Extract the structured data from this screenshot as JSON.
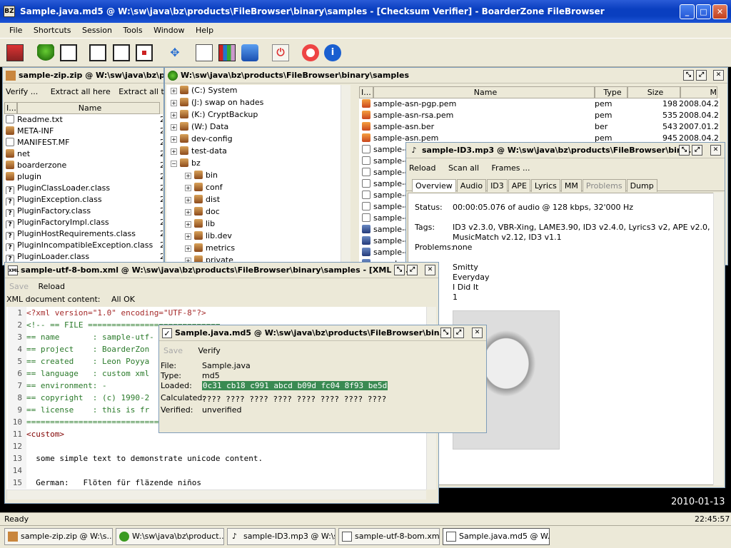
{
  "app": {
    "title": "Sample.java.md5 @ W:\\sw\\java\\bz\\products\\FileBrowser\\binary\\samples - [Checksum Verifier] - BoarderZone FileBrowser"
  },
  "menu": [
    "File",
    "Shortcuts",
    "Session",
    "Tools",
    "Window",
    "Help"
  ],
  "zip": {
    "title": "sample-zip.zip @ W:\\sw\\java\\bz\\pi",
    "actions": [
      "Verify ...",
      "Extract all here",
      "Extract all to ..."
    ],
    "col_i": "I...",
    "col_name": "Name",
    "rows": [
      {
        "name": "Readme.txt",
        "icon": "file",
        "n": "2"
      },
      {
        "name": "META-INF",
        "icon": "folder",
        "n": "2"
      },
      {
        "name": "MANIFEST.MF",
        "icon": "file",
        "n": "2"
      },
      {
        "name": "net",
        "icon": "folder",
        "n": "2"
      },
      {
        "name": "boarderzone",
        "icon": "folder",
        "n": "2"
      },
      {
        "name": "plugin",
        "icon": "folder",
        "n": "2"
      },
      {
        "name": "PluginClassLoader.class",
        "icon": "q",
        "n": "2"
      },
      {
        "name": "PluginException.class",
        "icon": "q",
        "n": "2"
      },
      {
        "name": "PluginFactory.class",
        "icon": "q",
        "n": "2"
      },
      {
        "name": "PluginFactoryImpl.class",
        "icon": "q",
        "n": "2"
      },
      {
        "name": "PluginHostRequirements.class",
        "icon": "q",
        "n": "2"
      },
      {
        "name": "PluginIncompatibleException.class",
        "icon": "q",
        "n": "2"
      },
      {
        "name": "PluginLoader.class",
        "icon": "q",
        "n": "2"
      }
    ]
  },
  "browser": {
    "title": "W:\\sw\\java\\bz\\products\\FileBrowser\\binary\\samples",
    "tree": [
      {
        "label": "(C:) System",
        "lvl": 0
      },
      {
        "label": "(J:) swap on hades",
        "lvl": 0
      },
      {
        "label": "(K:) CryptBackup",
        "lvl": 0
      },
      {
        "label": "(W:) Data",
        "lvl": 0
      },
      {
        "label": "dev-config",
        "lvl": 0
      },
      {
        "label": "test-data",
        "lvl": 0
      },
      {
        "label": "bz",
        "lvl": 0
      },
      {
        "label": "bin",
        "lvl": 1
      },
      {
        "label": "conf",
        "lvl": 1
      },
      {
        "label": "dist",
        "lvl": 1
      },
      {
        "label": "doc",
        "lvl": 1
      },
      {
        "label": "lib",
        "lvl": 1
      },
      {
        "label": "lib.dev",
        "lvl": 1
      },
      {
        "label": "metrics",
        "lvl": 1
      },
      {
        "label": "private",
        "lvl": 1
      }
    ],
    "cols": {
      "i": "I...",
      "name": "Name",
      "type": "Type",
      "size": "Size",
      "m": "M"
    },
    "files": [
      {
        "name": "sample-asn-pgp.pem",
        "type": "pem",
        "size": "198",
        "date": "2008.04.2"
      },
      {
        "name": "sample-asn-rsa.pem",
        "type": "pem",
        "size": "535",
        "date": "2008.04.2"
      },
      {
        "name": "sample-asn.ber",
        "type": "ber",
        "size": "543",
        "date": "2007.01.2"
      },
      {
        "name": "sample-asn.pem",
        "type": "pem",
        "size": "945",
        "date": "2008.04.2"
      }
    ],
    "partial": [
      "sample-ce",
      "sample-ce",
      "sample-ce",
      "sample-ce",
      "sample-ce",
      "sample-ce",
      "sample-cc",
      "sample-di",
      "sample-di",
      "sample-di",
      "sample-di"
    ]
  },
  "mp3": {
    "title": "sample-ID3.mp3 @ W:\\sw\\java\\bz\\products\\FileBrowser\\bin...",
    "actions": [
      "Reload",
      "Scan all",
      "Frames ..."
    ],
    "tabs": [
      "Overview",
      "Audio",
      "ID3",
      "APE",
      "Lyrics",
      "MM",
      "Problems",
      "Dump"
    ],
    "status_label": "Status:",
    "status": "00:00:05.076 of audio @ 128 kbps, 32'000 Hz",
    "tags_label": "Tags:",
    "tags1": "ID3 v2.3.0, VBR-Xing, LAME3.90, ID3 v2.4.0, Lyrics3 v2, APE v2.0,",
    "tags2": "MusicMatch v2.12, ID3 v1.1",
    "problems_label": "Problems:",
    "problems": "none",
    "info": [
      "Smitty",
      "Everyday",
      "I Did It",
      "1"
    ]
  },
  "xml": {
    "title": "sample-utf-8-bom.xml @ W:\\sw\\java\\bz\\products\\FileBrowser\\binary\\samples - [XML E...",
    "save": "Save",
    "reload": "Reload",
    "content_label": "XML document content:",
    "content_status": "All OK",
    "lines": [
      {
        "n": "1",
        "t": "<?xml version=\"1.0\" encoding=\"UTF-8\"?>"
      },
      {
        "n": "2",
        "t": "<!-- == FILE ============================"
      },
      {
        "n": "3",
        "t": "== name       : sample-utf-"
      },
      {
        "n": "4",
        "t": "== project    : BoarderZon"
      },
      {
        "n": "5",
        "t": "== created    : Leon Poyya"
      },
      {
        "n": "6",
        "t": "== language   : custom xml"
      },
      {
        "n": "7",
        "t": "== environment: -"
      },
      {
        "n": "8",
        "t": "== copyright  : (c) 1990-2"
      },
      {
        "n": "9",
        "t": "== license    : this is fr"
      },
      {
        "n": "10",
        "t": "==============================="
      },
      {
        "n": "11",
        "t": "<custom>"
      },
      {
        "n": "12",
        "t": ""
      },
      {
        "n": "13",
        "t": "  some simple text to demonstrate unicode content."
      },
      {
        "n": "14",
        "t": ""
      },
      {
        "n": "15",
        "t": "  German:   Flöten für fläzende niños"
      }
    ]
  },
  "md5": {
    "title": "Sample.java.md5 @ W:\\sw\\java\\bz\\products\\FileBrowser\\bin...",
    "save": "Save",
    "verify": "Verify",
    "file_label": "File:",
    "file": "Sample.java",
    "type_label": "Type:",
    "type": "md5",
    "loaded_label": "Loaded:",
    "loaded": "0c31 cb18 c991 abcd b09d fc04 8f93 be5d",
    "calc_label": "Calculated:",
    "calc": "???? ???? ???? ???? ???? ???? ???? ????",
    "verified_label": "Verified:",
    "verified": "unverified"
  },
  "desktop_date": "2010-01-13",
  "status": {
    "text": "Ready",
    "time": "22:45:57"
  },
  "tasks": [
    "sample-zip.zip @ W:\\s...",
    "W:\\sw\\java\\bz\\product...",
    "sample-ID3.mp3 @ W:\\s...",
    "sample-utf-8-bom.xml ...",
    "Sample.java.md5 @ W..."
  ]
}
